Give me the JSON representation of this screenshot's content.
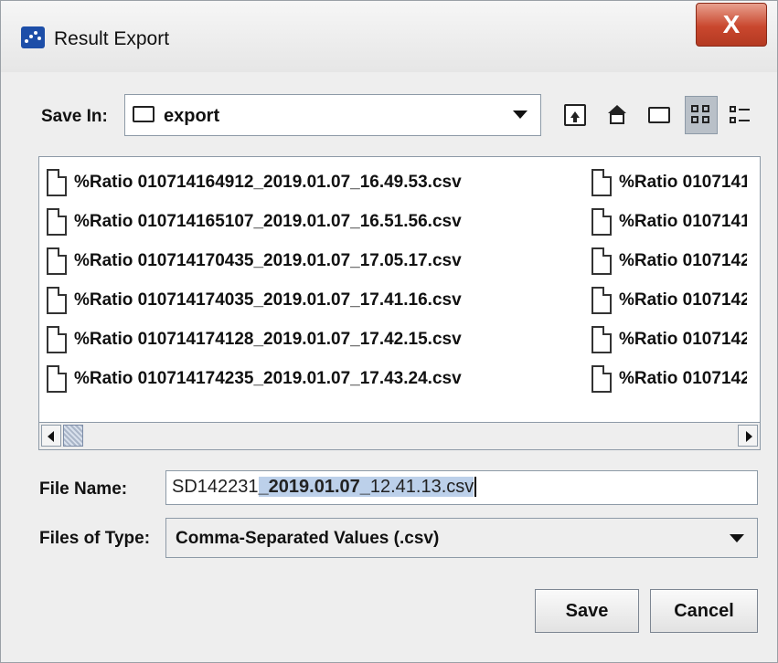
{
  "window": {
    "title": "Result Export",
    "close_label": "X"
  },
  "save_in": {
    "label": "Save In:",
    "folder": "export"
  },
  "toolbar": [
    "up-one-level-icon",
    "home-icon",
    "new-folder-icon",
    "list-view-icon",
    "details-view-icon"
  ],
  "files_col1": [
    "%Ratio 010714164912_2019.01.07_16.49.53.csv",
    "%Ratio 010714165107_2019.01.07_16.51.56.csv",
    "%Ratio 010714170435_2019.01.07_17.05.17.csv",
    "%Ratio 010714174035_2019.01.07_17.41.16.csv",
    "%Ratio 010714174128_2019.01.07_17.42.15.csv",
    "%Ratio 010714174235_2019.01.07_17.43.24.csv"
  ],
  "files_col2": [
    "%Ratio 0107141",
    "%Ratio 0107141",
    "%Ratio 0107142",
    "%Ratio 0107142",
    "%Ratio 0107142",
    "%Ratio 0107142"
  ],
  "form": {
    "file_name_label": "File Name:",
    "file_name_parts": [
      "SD142231",
      "_2019.01.07_",
      "12.41.13.csv"
    ],
    "files_of_type_label": "Files of Type:",
    "files_of_type_value": "Comma-Separated Values (.csv)"
  },
  "buttons": {
    "save": "Save",
    "cancel": "Cancel"
  }
}
